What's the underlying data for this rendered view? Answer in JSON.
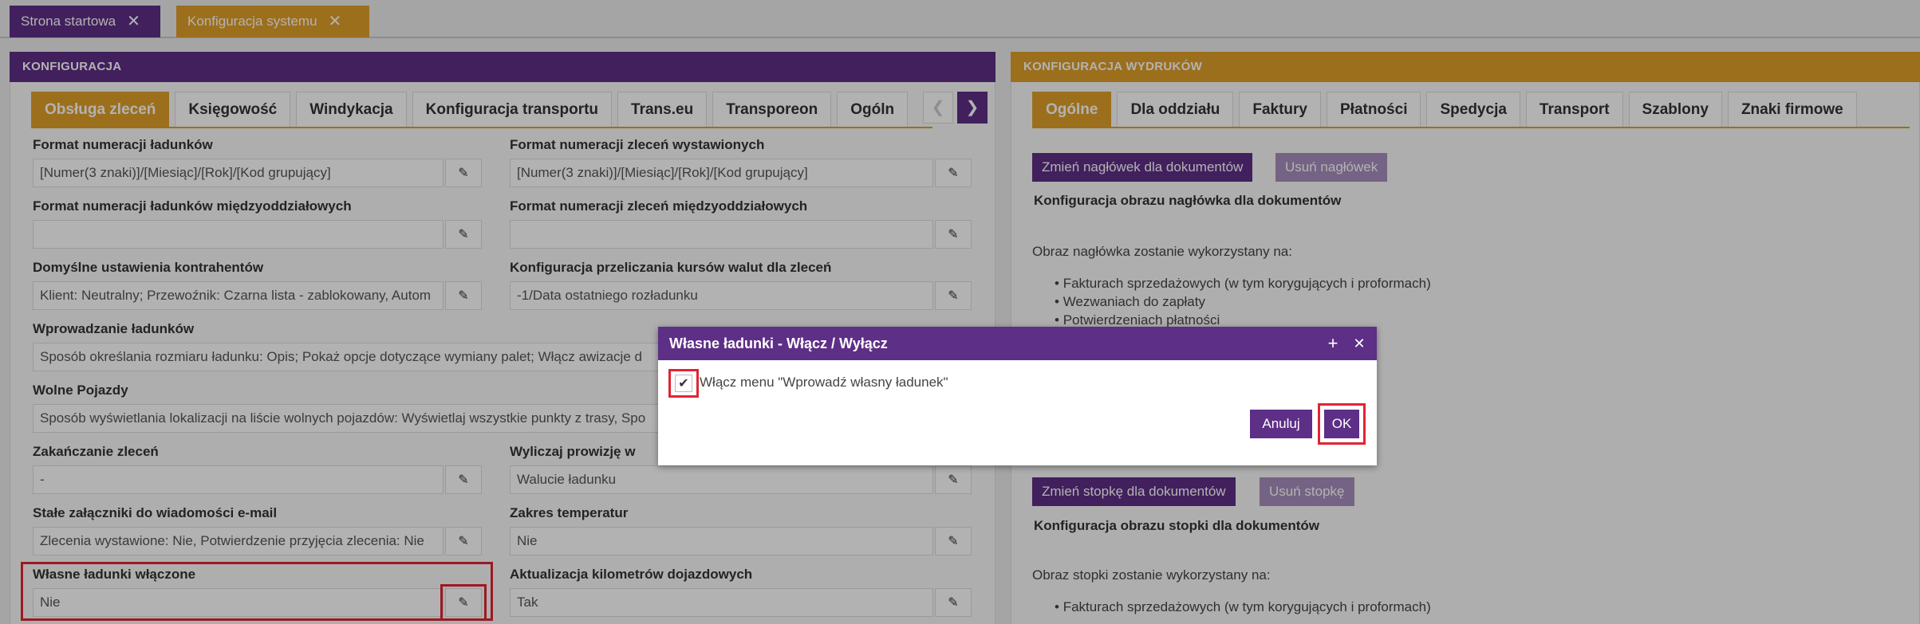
{
  "app_tabs": [
    {
      "label": "Strona startowa"
    },
    {
      "label": "Konfiguracja systemu"
    }
  ],
  "left_panel": {
    "title": "KONFIGURACJA",
    "tabs": [
      "Obsługa zleceń",
      "Księgowość",
      "Windykacja",
      "Konfiguracja transportu",
      "Trans.eu",
      "Transporeon",
      "Ogóln"
    ],
    "fields": {
      "f1": {
        "label": "Format numeracji ładunków",
        "value": "[Numer(3 znaki)]/[Miesiąc]/[Rok]/[Kod grupujący]"
      },
      "f2": {
        "label": "Format numeracji zleceń wystawionych",
        "value": "[Numer(3 znaki)]/[Miesiąc]/[Rok]/[Kod grupujący]"
      },
      "f3": {
        "label": "Format numeracji ładunków międzyoddziałowych",
        "value": ""
      },
      "f4": {
        "label": "Format numeracji zleceń międzyoddziałowych",
        "value": ""
      },
      "f5": {
        "label": "Domyślne ustawienia kontrahentów",
        "value": "Klient: Neutralny; Przewoźnik: Czarna lista - zablokowany, Autom"
      },
      "f6": {
        "label": "Konfiguracja przeliczania kursów walut dla zleceń",
        "value": "-1/Data ostatniego rozładunku"
      },
      "f7": {
        "label": "Wprowadzanie ładunków",
        "value": "Sposób określania rozmiaru ładunku: Opis; Pokaż opcje dotyczące wymiany palet; Włącz awizacje d"
      },
      "f8": {
        "label": "Wolne Pojazdy",
        "value": "Sposób wyświetlania lokalizacji na liście wolnych pojazdów: Wyświetlaj wszystkie punkty z trasy, Spo"
      },
      "f9": {
        "label": "Zakańczanie zleceń",
        "value": "-"
      },
      "f10": {
        "label": "Wyliczaj prowizję w",
        "value": "Walucie ładunku"
      },
      "f11": {
        "label": "Stałe załączniki do wiadomości e-mail",
        "value": "Zlecenia wystawione: Nie, Potwierdzenie przyjęcia zlecenia: Nie"
      },
      "f12": {
        "label": "Zakres temperatur",
        "value": "Nie"
      },
      "f13": {
        "label": "Własne ładunki włączone",
        "value": "Nie"
      },
      "f14": {
        "label": "Aktualizacja kilometrów dojazdowych",
        "value": "Tak"
      }
    }
  },
  "right_panel": {
    "title": "KONFIGURACJA WYDRUKÓW",
    "tabs": [
      "Ogólne",
      "Dla oddziału",
      "Faktury",
      "Płatności",
      "Spedycja",
      "Transport",
      "Szablony",
      "Znaki firmowe"
    ],
    "header_change_btn": "Zmień nagłówek dla dokumentów",
    "header_remove_btn": "Usuń nagłówek",
    "header_section_title": "Konfiguracja obrazu nagłówka dla dokumentów",
    "header_used_on": "Obraz nagłówka zostanie wykorzystany na:",
    "header_list": [
      "Fakturach sprzedażowych (w tym korygujących i proformach)",
      "Wezwaniach do zapłaty",
      "Potwierdzeniach płatności"
    ],
    "footer_change_btn": "Zmień stopkę dla dokumentów",
    "footer_remove_btn": "Usuń stopkę",
    "footer_section_title": "Konfiguracja obrazu stopki dla dokumentów",
    "footer_used_on": "Obraz stopki zostanie wykorzystany na:",
    "footer_list": [
      "Fakturach sprzedażowych (w tym korygujących i proformach)"
    ]
  },
  "dialog": {
    "title": "Własne ładunki - Włącz / Wyłącz",
    "checkbox_label": "Włącz menu \"Wprowadź własny ładunek\"",
    "checkbox_checked": true,
    "cancel_label": "Anuluj",
    "ok_label": "OK"
  },
  "colors": {
    "purple": "#5e2f86",
    "orange": "#e0a02a",
    "highlight": "#e02433"
  }
}
